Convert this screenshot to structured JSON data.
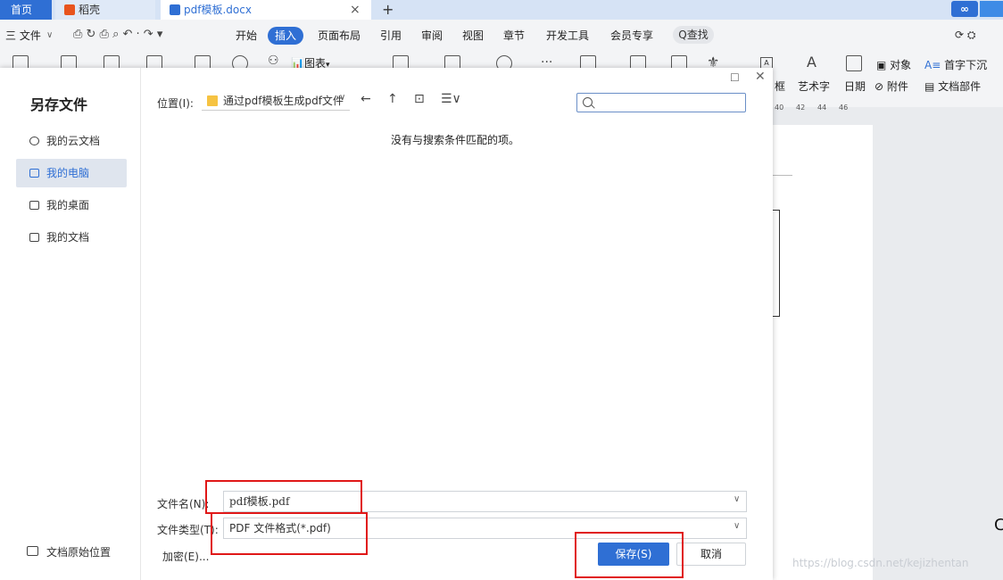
{
  "tabs": {
    "home": "首页",
    "daoke": "稻壳",
    "document": "pdf模板.docx",
    "close_glyph": "×",
    "add_glyph": "+"
  },
  "menubar": {
    "file": "三 文件",
    "start": "开始",
    "insert": "插入",
    "layout": "页面布局",
    "reference": "引用",
    "review": "审阅",
    "view": "视图",
    "section": "章节",
    "devtools": "开发工具",
    "member": "会员专享",
    "find": "Q查找"
  },
  "ribbon": {
    "chart": "图表",
    "textbox": "框",
    "wordart": "艺术字",
    "date": "日期",
    "attachment": "附件",
    "object": "对象",
    "dropcap": "首字下沉",
    "docparts": "文档部件"
  },
  "ruler": [
    "40",
    "42",
    "44",
    "46"
  ],
  "watermark": "https://blog.csdn.net/kejizhentan",
  "dialog": {
    "title": "另存文件",
    "nav": {
      "cloud": "我的云文档",
      "pc": "我的电脑",
      "desktop": "我的桌面",
      "docs": "我的文档"
    },
    "original_location": "文档原始位置",
    "location_label": "位置(I):",
    "location_path": "通过pdf模板生成pdf文件",
    "search_placeholder": "",
    "empty_message": "没有与搜索条件匹配的项。",
    "filename_label": "文件名(N):",
    "filename_value": "pdf模板.pdf",
    "filetype_label": "文件类型(T):",
    "filetype_value": "PDF 文件格式(*.pdf)",
    "encrypt_label": "加密(E)...",
    "save_label": "保存(S)",
    "cancel_label": "取消"
  },
  "colors": {
    "accent": "#2f6fd4",
    "highlight": "#e01818"
  }
}
